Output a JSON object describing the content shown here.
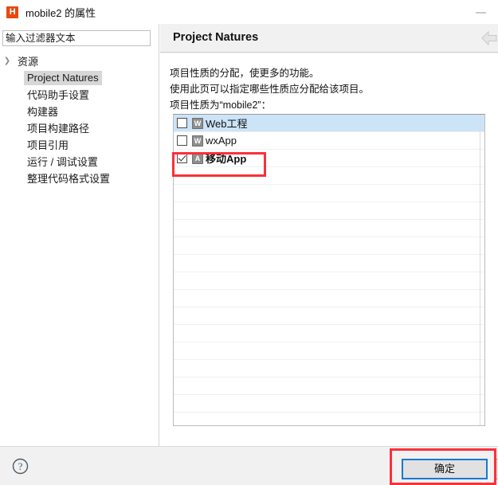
{
  "window": {
    "title": "mobile2 的属性",
    "app_icon_letter": "H",
    "minimize_label": "—"
  },
  "sidebar": {
    "filter": {
      "placeholder": "输入过滤器文本",
      "value": ""
    },
    "items": [
      {
        "label": "资源",
        "level": 0,
        "expandable": true,
        "chevron": "❯",
        "selected": false
      },
      {
        "label": "Project Natures",
        "level": 1,
        "expandable": false,
        "chevron": "",
        "selected": true
      },
      {
        "label": "代码助手设置",
        "level": 1,
        "expandable": false,
        "chevron": "",
        "selected": false
      },
      {
        "label": "构建器",
        "level": 1,
        "expandable": false,
        "chevron": "",
        "selected": false
      },
      {
        "label": "项目构建路径",
        "level": 1,
        "expandable": false,
        "chevron": "",
        "selected": false
      },
      {
        "label": "项目引用",
        "level": 1,
        "expandable": false,
        "chevron": "",
        "selected": false
      },
      {
        "label": "运行 / 调试设置",
        "level": 1,
        "expandable": false,
        "chevron": "",
        "selected": false
      },
      {
        "label": "整理代码格式设置",
        "level": 1,
        "expandable": false,
        "chevron": "",
        "selected": false
      }
    ]
  },
  "page": {
    "title": "Project Natures",
    "back_arrow_icon": "left-arrow-icon",
    "description": [
      "项目性质的分配，使更多的功能。",
      "使用此页可以指定哪些性质应分配给该项目。",
      "项目性质为“mobile2”："
    ],
    "natures": [
      {
        "label": "Web工程",
        "icon_letter": "W",
        "checked": false,
        "selected": true,
        "bold": false
      },
      {
        "label": "wxApp",
        "icon_letter": "W",
        "checked": false,
        "selected": false,
        "bold": false
      },
      {
        "label": "移动App",
        "icon_letter": "A",
        "checked": true,
        "selected": false,
        "bold": true
      }
    ],
    "empty_row_count": 15
  },
  "footer": {
    "help_icon": "question-mark-icon",
    "ok_label": "确定"
  },
  "annotations": {
    "highlight_color": "#fc2f3b",
    "boxes": [
      "nature-mobile-app-row",
      "ok-button"
    ]
  },
  "colors": {
    "app_icon": "#e8470f",
    "selection": "#cce4f7",
    "tree_selection": "#d7d7d7",
    "focus_border": "#1978d4",
    "panel_bg": "#f1f1f1"
  }
}
